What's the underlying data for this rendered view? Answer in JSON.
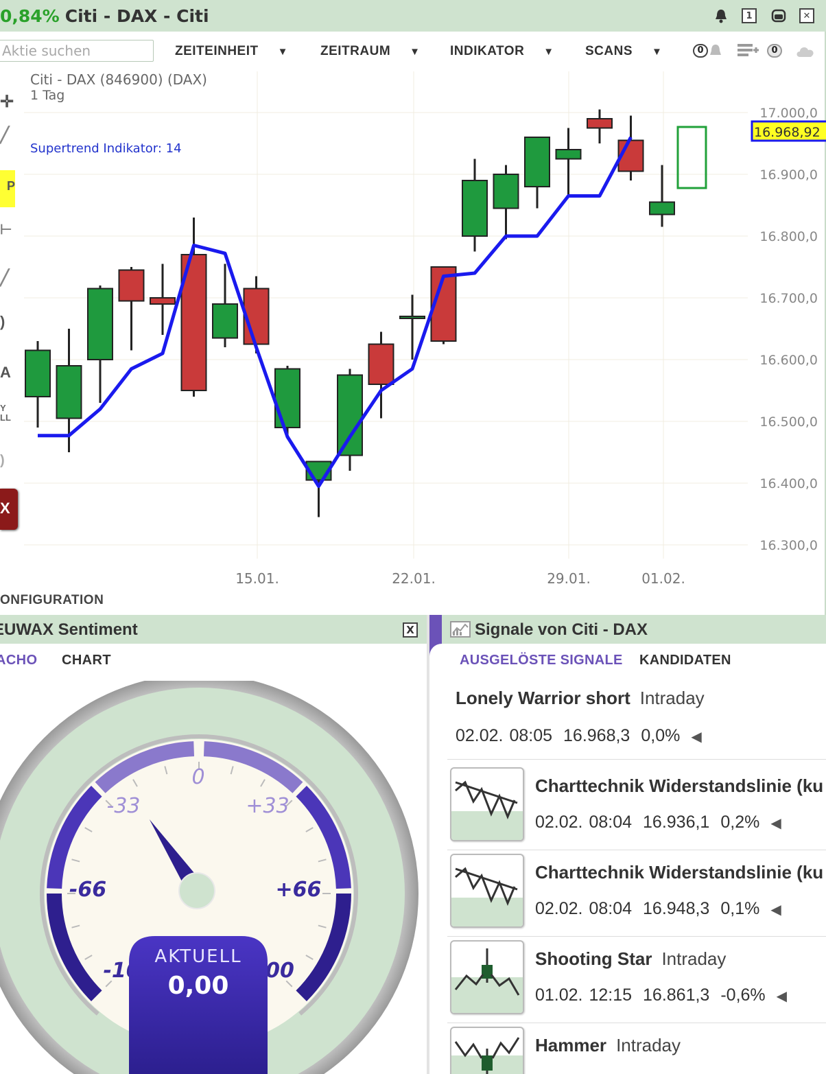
{
  "window": {
    "change": "0,84%",
    "title": "Citi - DAX - Citi"
  },
  "toolbar": {
    "search_placeholder": "Aktie suchen",
    "menus": [
      {
        "label": "ZEITEINHEIT"
      },
      {
        "label": "ZEITRAUM"
      },
      {
        "label": "INDIKATOR"
      },
      {
        "label": "SCANS"
      }
    ],
    "alarm_count": "0",
    "watchlist_count": "0",
    "caret": "▼"
  },
  "chart": {
    "instrument": "Citi - DAX (846900) (DAX)",
    "interval": "1 Tag",
    "indicator_label": "Supertrend Indikator: 14",
    "current_price_label": "16.968,92",
    "y_tick_labels": [
      "17.000,0",
      "16.900,0",
      "16.800,0",
      "16.700,0",
      "16.600,0",
      "16.500,0",
      "16.400,0",
      "16.300,0"
    ],
    "x_tick_labels": [
      "15.01.",
      "22.01.",
      "29.01.",
      "01.02."
    ],
    "configuration_label": "ONFIGURATION"
  },
  "chart_data": {
    "type": "candlestick",
    "ylim": [
      16260,
      17030
    ],
    "y_ticks": [
      17000,
      16900,
      16800,
      16700,
      16600,
      16500,
      16400,
      16300
    ],
    "candles": [
      {
        "o": 16540,
        "h": 16630,
        "l": 16490,
        "c": 16615
      },
      {
        "o": 16505,
        "h": 16650,
        "l": 16450,
        "c": 16590
      },
      {
        "o": 16600,
        "h": 16720,
        "l": 16530,
        "c": 16715
      },
      {
        "o": 16745,
        "h": 16750,
        "l": 16615,
        "c": 16695
      },
      {
        "o": 16700,
        "h": 16755,
        "l": 16640,
        "c": 16690
      },
      {
        "o": 16770,
        "h": 16830,
        "l": 16540,
        "c": 16550
      },
      {
        "o": 16635,
        "h": 16755,
        "l": 16620,
        "c": 16690
      },
      {
        "o": 16715,
        "h": 16735,
        "l": 16610,
        "c": 16625
      },
      {
        "o": 16490,
        "h": 16590,
        "l": 16475,
        "c": 16585
      },
      {
        "o": 16405,
        "h": 16435,
        "l": 16345,
        "c": 16435
      },
      {
        "o": 16445,
        "h": 16585,
        "l": 16420,
        "c": 16575
      },
      {
        "o": 16625,
        "h": 16645,
        "l": 16505,
        "c": 16560
      },
      {
        "o": 16670,
        "h": 16705,
        "l": 16600,
        "c": 16670
      },
      {
        "o": 16750,
        "h": 16750,
        "l": 16625,
        "c": 16630
      },
      {
        "o": 16800,
        "h": 16925,
        "l": 16775,
        "c": 16890
      },
      {
        "o": 16845,
        "h": 16915,
        "l": 16795,
        "c": 16900
      },
      {
        "o": 16880,
        "h": 16960,
        "l": 16845,
        "c": 16960
      },
      {
        "o": 16925,
        "h": 16975,
        "l": 16865,
        "c": 16940
      },
      {
        "o": 16990,
        "h": 17005,
        "l": 16950,
        "c": 16975
      },
      {
        "o": 16955,
        "h": 16995,
        "l": 16890,
        "c": 16905
      },
      {
        "o": 16835,
        "h": 16915,
        "l": 16815,
        "c": 16855
      }
    ],
    "supertrend": [
      16477,
      16477,
      16520,
      16585,
      16610,
      16785,
      16772,
      16620,
      16475,
      16395,
      16475,
      16550,
      16585,
      16735,
      16740,
      16800,
      16800,
      16865,
      16865,
      16960
    ]
  },
  "sentiment": {
    "title": "EUWAX Sentiment",
    "close": "X",
    "tabs": [
      {
        "label": "ACHO"
      },
      {
        "label": "CHART"
      }
    ],
    "scale_labels": {
      "zero": "0",
      "m33": "-33",
      "p33": "+33",
      "m66": "-66",
      "p66": "+66",
      "m100": "-100",
      "p100": "+100"
    },
    "needle_value": -25,
    "current_label": "AKTUELL",
    "current_value": "0,00",
    "colors": {
      "accent": "#6b52b8",
      "dark": "#3a2b9e",
      "light": "#9f8fd6"
    }
  },
  "signals": {
    "title": "Signale von Citi - DAX",
    "tabs": [
      {
        "label": "AUSGELÖSTE SIGNALE"
      },
      {
        "label": "KANDIDATEN"
      }
    ],
    "items": [
      {
        "name": "Lonely Warrior short",
        "timeframe": "Intraday",
        "datetime": "02.02. 08:05",
        "price": "16.968,3",
        "pct": "0,0%",
        "icon": "none"
      },
      {
        "name": "Charttechnik Widerstandslinie (ku",
        "timeframe": "",
        "datetime": "02.02. 08:04",
        "price": "16.936,1",
        "pct": "0,2%",
        "icon": "resistance-line-icon"
      },
      {
        "name": "Charttechnik Widerstandslinie (ku",
        "timeframe": "",
        "datetime": "02.02. 08:04",
        "price": "16.948,3",
        "pct": "0,1%",
        "icon": "resistance-line-icon"
      },
      {
        "name": "Shooting Star",
        "timeframe": "Intraday",
        "datetime": "01.02. 12:15",
        "price": "16.861,3",
        "pct": "-0,6%",
        "icon": "shooting-star-icon"
      },
      {
        "name": "Hammer",
        "timeframe": "Intraday",
        "datetime": "",
        "price": "",
        "pct": "",
        "icon": "hammer-icon"
      }
    ]
  }
}
